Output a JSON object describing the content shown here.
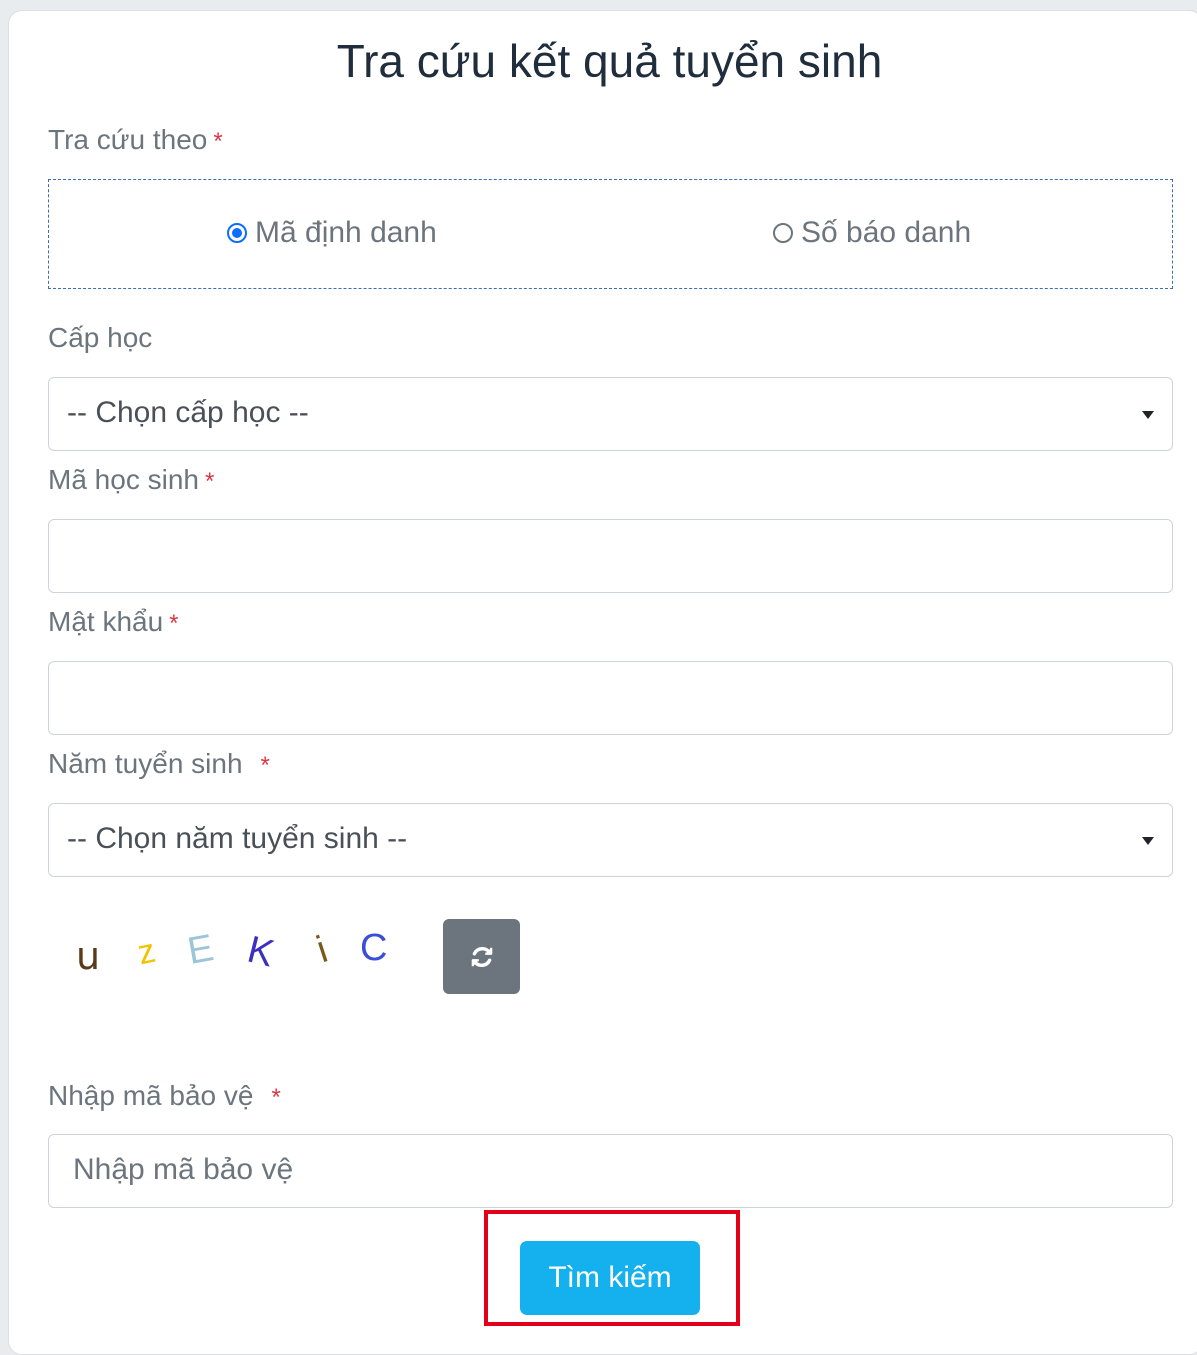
{
  "title": "Tra cứu kết quả tuyển sinh",
  "lookup_by": {
    "label": "Tra cứu theo",
    "required_mark": "*",
    "options": [
      {
        "label": "Mã định danh",
        "selected": true
      },
      {
        "label": "Số báo danh",
        "selected": false
      }
    ]
  },
  "level": {
    "label": "Cấp học",
    "selected": "-- Chọn cấp học --"
  },
  "student_id": {
    "label": "Mã học sinh",
    "required_mark": "*",
    "value": ""
  },
  "password": {
    "label": "Mật khẩu",
    "required_mark": "*",
    "value": ""
  },
  "year": {
    "label": "Năm tuyển sinh",
    "required_mark": "*",
    "selected": "-- Chọn năm tuyển sinh --"
  },
  "captcha": {
    "chars": [
      "u",
      "z",
      "E",
      "K",
      "i",
      "C"
    ],
    "colors": [
      "#5a3a1a",
      "#f2c300",
      "#9cc6d8",
      "#3a2fc0",
      "#7a5a1a",
      "#3a4fd8"
    ],
    "refresh_icon": "refresh-icon"
  },
  "security_code": {
    "label": "Nhập mã bảo vệ",
    "required_mark": "*",
    "placeholder": "Nhập mã bảo vệ"
  },
  "search_button": {
    "label": "Tìm kiếm",
    "color": "#14b1ee",
    "highlight_color": "#e3001b"
  }
}
